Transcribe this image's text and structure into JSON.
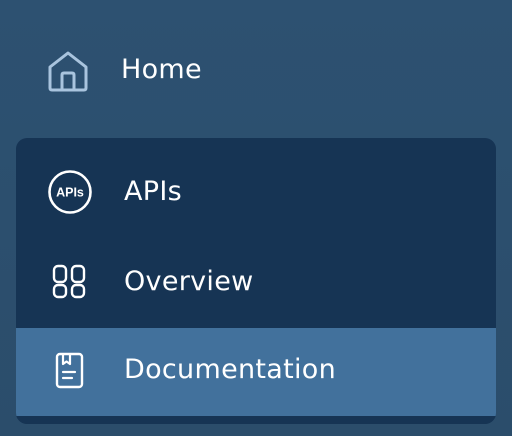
{
  "nav": {
    "home": {
      "label": "Home",
      "icon": "home-icon"
    },
    "group": {
      "items": [
        {
          "label": "APIs",
          "icon": "apis-badge-icon",
          "icon_text": "APIs",
          "selected": false
        },
        {
          "label": "Overview",
          "icon": "grid-icon",
          "selected": false
        },
        {
          "label": "Documentation",
          "icon": "document-icon",
          "selected": true
        }
      ]
    }
  },
  "colors": {
    "background": "#2c5070",
    "group_background": "#163454",
    "selected_background": "#42719c",
    "home_icon": "#a9c4de",
    "text": "#ffffff"
  }
}
